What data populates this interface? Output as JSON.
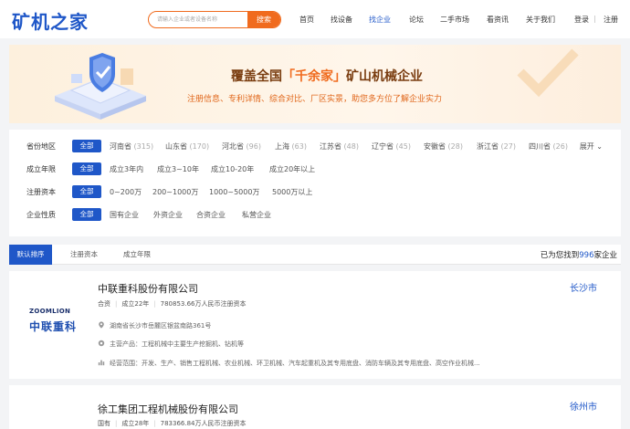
{
  "header": {
    "logo": "矿机之家",
    "search_placeholder": "请输入企业或者设备名称",
    "search_button": "搜索",
    "nav": [
      "首页",
      "找设备",
      "找企业",
      "论坛",
      "二手市场",
      "看资讯",
      "关于我们"
    ],
    "login": "登录",
    "separator": "|",
    "register": "注册"
  },
  "banner": {
    "title_pre": "覆盖全国",
    "title_hl": "「千余家」",
    "title_post": "矿山机械企业",
    "subtitle": "注册信息、专利详情、综合对比、厂区实景，助您多方位了解企业实力"
  },
  "filters": {
    "rows": [
      {
        "label": "省份地区",
        "all": "全部",
        "options": [
          {
            "name": "河南省",
            "count": "(315)"
          },
          {
            "name": "山东省",
            "count": "(170)"
          },
          {
            "name": "河北省",
            "count": "(96)"
          },
          {
            "name": "上海",
            "count": "(63)"
          },
          {
            "name": "江苏省",
            "count": "(48)"
          },
          {
            "name": "辽宁省",
            "count": "(45)"
          },
          {
            "name": "安徽省",
            "count": "(28)"
          },
          {
            "name": "浙江省",
            "count": "(27)"
          },
          {
            "name": "四川省",
            "count": "(26)"
          }
        ]
      },
      {
        "label": "成立年限",
        "all": "全部",
        "options": [
          {
            "name": "成立3年内"
          },
          {
            "name": "成立3~10年"
          },
          {
            "name": "成立10-20年"
          },
          {
            "name": "成立20年以上"
          }
        ]
      },
      {
        "label": "注册资本",
        "all": "全部",
        "options": [
          {
            "name": "0~200万"
          },
          {
            "name": "200~1000万"
          },
          {
            "name": "1000~5000万"
          },
          {
            "name": "5000万以上"
          }
        ]
      },
      {
        "label": "企业性质",
        "all": "全部",
        "options": [
          {
            "name": "国有企业"
          },
          {
            "name": "外资企业"
          },
          {
            "name": "合资企业"
          },
          {
            "name": "私营企业"
          }
        ]
      }
    ],
    "expand": "展开"
  },
  "tabs": [
    "默认排序",
    "注册资本",
    "成立年限"
  ],
  "found": {
    "pre": "已为您找到",
    "num": "996",
    "post": "家企业"
  },
  "companies": [
    {
      "name": "中联重科股份有限公司",
      "city": "长沙市",
      "type": "合资",
      "age": "成立22年",
      "capital": "780853.66万人民币注册资本",
      "address": "湖南省长沙市岳麓区银盆南路361号",
      "products": "主营产品：工程机械中主要生产挖掘机、钻机等",
      "scope": "经营范围：开发、生产、销售工程机械、农业机械、环卫机械、汽车起重机及其专用底盘、消防车辆及其专用底盘、高空作业机械...",
      "logo_text": "中联重科",
      "logo_en": "ZOOMLION"
    },
    {
      "name": "徐工集团工程机械股份有限公司",
      "city": "徐州市",
      "type": "国有",
      "age": "成立28年",
      "capital": "783366.84万人民币注册资本"
    }
  ],
  "colors": {
    "brand": "#1f57c8",
    "accent": "#f06b1e"
  }
}
